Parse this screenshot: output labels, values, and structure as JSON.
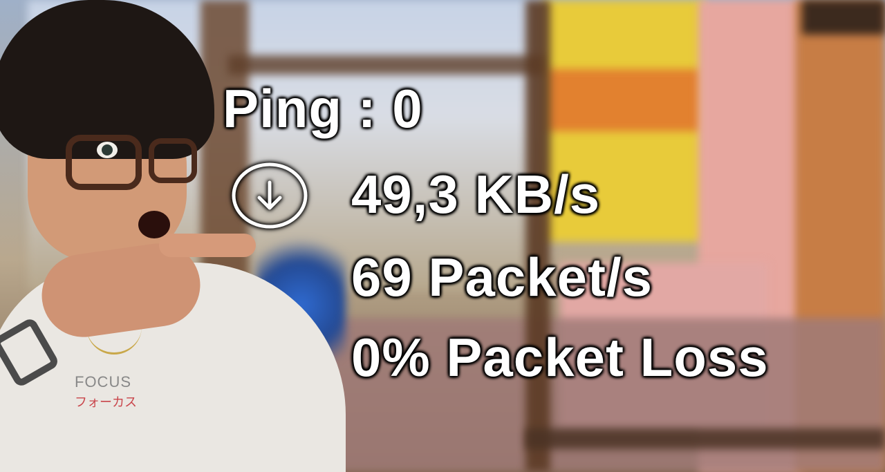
{
  "overlay": {
    "ping": "Ping : 0",
    "download_speed": "49,3 KB/s",
    "packet_rate": "69 Packet/s",
    "packet_loss": "0% Packet Loss",
    "download_icon": "arrow-down-circle-icon"
  },
  "shirt_print": {
    "line1": "FOCUS",
    "line2": "フォーカス"
  },
  "colors": {
    "text": "#ffffff",
    "text_outline": "#000000"
  }
}
